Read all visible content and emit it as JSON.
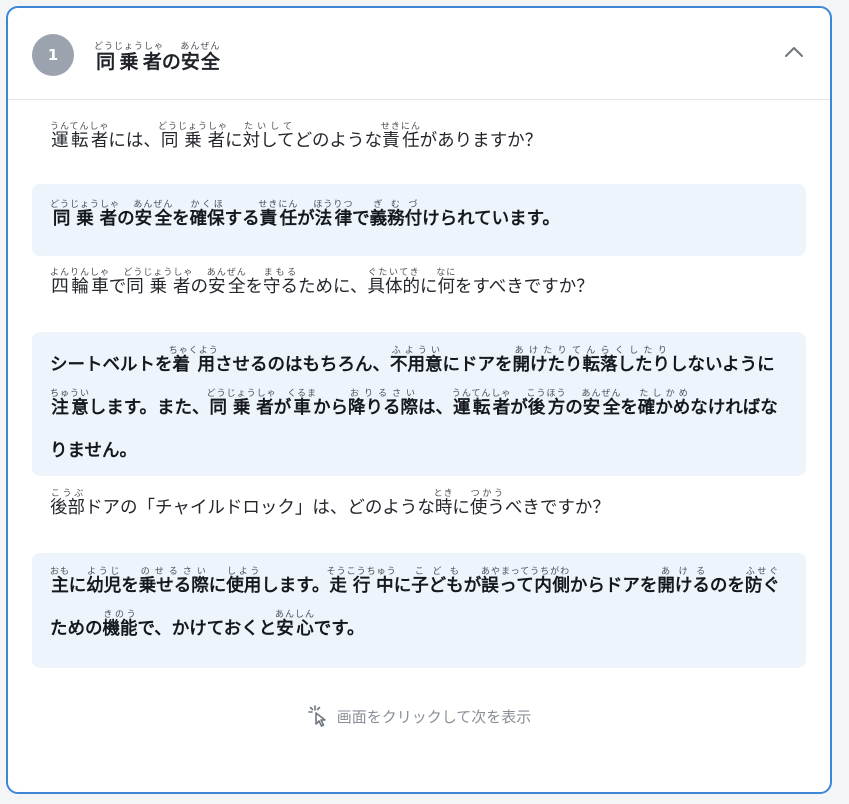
{
  "card": {
    "step_number": "1",
    "title": {
      "segments": [
        {
          "text": "同乗者",
          "ruby": "どうじょうしゃ"
        },
        {
          "text": "の"
        },
        {
          "text": "安全",
          "ruby": "あんぜん"
        }
      ]
    },
    "collapse_icon": "chevron-up-icon"
  },
  "qa": [
    {
      "question": [
        {
          "text": "運転者",
          "ruby": "うんてんしゃ"
        },
        {
          "text": "には、"
        },
        {
          "text": "同乗者",
          "ruby": "どうじょうしゃ"
        },
        {
          "text": "に"
        },
        {
          "text": "対して",
          "ruby": "たいして"
        },
        {
          "text": "どのような"
        },
        {
          "text": "責任",
          "ruby": "せきにん"
        },
        {
          "text": "がありますか？"
        }
      ],
      "answer": [
        {
          "text": "同乗者",
          "ruby": "どうじょうしゃ"
        },
        {
          "text": "の"
        },
        {
          "text": "安全",
          "ruby": "あんぜん"
        },
        {
          "text": "を"
        },
        {
          "text": "確保",
          "ruby": "かくほ"
        },
        {
          "text": "する"
        },
        {
          "text": "責任",
          "ruby": "せきにん"
        },
        {
          "text": "が"
        },
        {
          "text": "法律",
          "ruby": "ほうりつ"
        },
        {
          "text": "で"
        },
        {
          "text": "義務付",
          "ruby": "ぎむづ"
        },
        {
          "text": "けられています。"
        }
      ]
    },
    {
      "question": [
        {
          "text": "四輪車",
          "ruby": "よんりんしゃ"
        },
        {
          "text": "で"
        },
        {
          "text": "同乗者",
          "ruby": "どうじょうしゃ"
        },
        {
          "text": "の"
        },
        {
          "text": "安全",
          "ruby": "あんぜん"
        },
        {
          "text": "を"
        },
        {
          "text": "守る",
          "ruby": "まもる"
        },
        {
          "text": "ために、"
        },
        {
          "text": "具体的",
          "ruby": "ぐたいてき"
        },
        {
          "text": "に"
        },
        {
          "text": "何",
          "ruby": "なに"
        },
        {
          "text": "をすべきですか？"
        }
      ],
      "answer": [
        {
          "text": "シートベルトを"
        },
        {
          "text": "着用",
          "ruby": "ちゃくよう"
        },
        {
          "text": "させるのはもちろん、"
        },
        {
          "text": "不用意",
          "ruby": "ふようい"
        },
        {
          "text": "にドアを"
        },
        {
          "text": "開けたり転落したり",
          "ruby": "あけたりてんらくしたり"
        },
        {
          "text": "しないように"
        },
        {
          "text": "注意",
          "ruby": "ちゅうい"
        },
        {
          "text": "します。また、"
        },
        {
          "text": "同乗者",
          "ruby": "どうじょうしゃ"
        },
        {
          "text": "が"
        },
        {
          "text": "車",
          "ruby": "くるま"
        },
        {
          "text": "から"
        },
        {
          "text": "降りる際",
          "ruby": "おりるさい"
        },
        {
          "text": "は、"
        },
        {
          "text": "運転者",
          "ruby": "うんてんしゃ"
        },
        {
          "text": "が"
        },
        {
          "text": "後方",
          "ruby": "こうほう"
        },
        {
          "text": "の"
        },
        {
          "text": "安全",
          "ruby": "あんぜん"
        },
        {
          "text": "を"
        },
        {
          "text": "確かめ",
          "ruby": "たしかめ"
        },
        {
          "text": "なければなりません。"
        }
      ]
    },
    {
      "question": [
        {
          "text": "後部",
          "ruby": "こうぶ"
        },
        {
          "text": "ドアの「チャイルドロック」は、どのような"
        },
        {
          "text": "時",
          "ruby": "とき"
        },
        {
          "text": "に"
        },
        {
          "text": "使う",
          "ruby": "つかう"
        },
        {
          "text": "べきですか？"
        }
      ],
      "answer": [
        {
          "text": "主",
          "ruby": "おも"
        },
        {
          "text": "に"
        },
        {
          "text": "幼児",
          "ruby": "ようじ"
        },
        {
          "text": "を"
        },
        {
          "text": "乗せる際",
          "ruby": "のせるさい"
        },
        {
          "text": "に"
        },
        {
          "text": "使用",
          "ruby": "しよう"
        },
        {
          "text": "します。"
        },
        {
          "text": "走行中",
          "ruby": "そうこうちゅう"
        },
        {
          "text": "に"
        },
        {
          "text": "子ども",
          "ruby": "こども"
        },
        {
          "text": "が"
        },
        {
          "text": "誤って内側",
          "ruby": "あやまってうちがわ"
        },
        {
          "text": "からドアを"
        },
        {
          "text": "開ける",
          "ruby": "あける"
        },
        {
          "text": "のを"
        },
        {
          "text": "防ぐ",
          "ruby": "ふせぐ"
        },
        {
          "text": "ための"
        },
        {
          "text": "機能",
          "ruby": "きのう"
        },
        {
          "text": "で、かけておくと"
        },
        {
          "text": "安心",
          "ruby": "あんしん"
        },
        {
          "text": "です。"
        }
      ]
    }
  ],
  "next_hint": {
    "label": "画面をクリックして次を表示",
    "icon": "click-cursor-icon"
  },
  "colors": {
    "border": "#3d86d6",
    "badge": "#9aa3ae",
    "answer_bg": "#eef4fc",
    "hint": "#8a9099"
  }
}
